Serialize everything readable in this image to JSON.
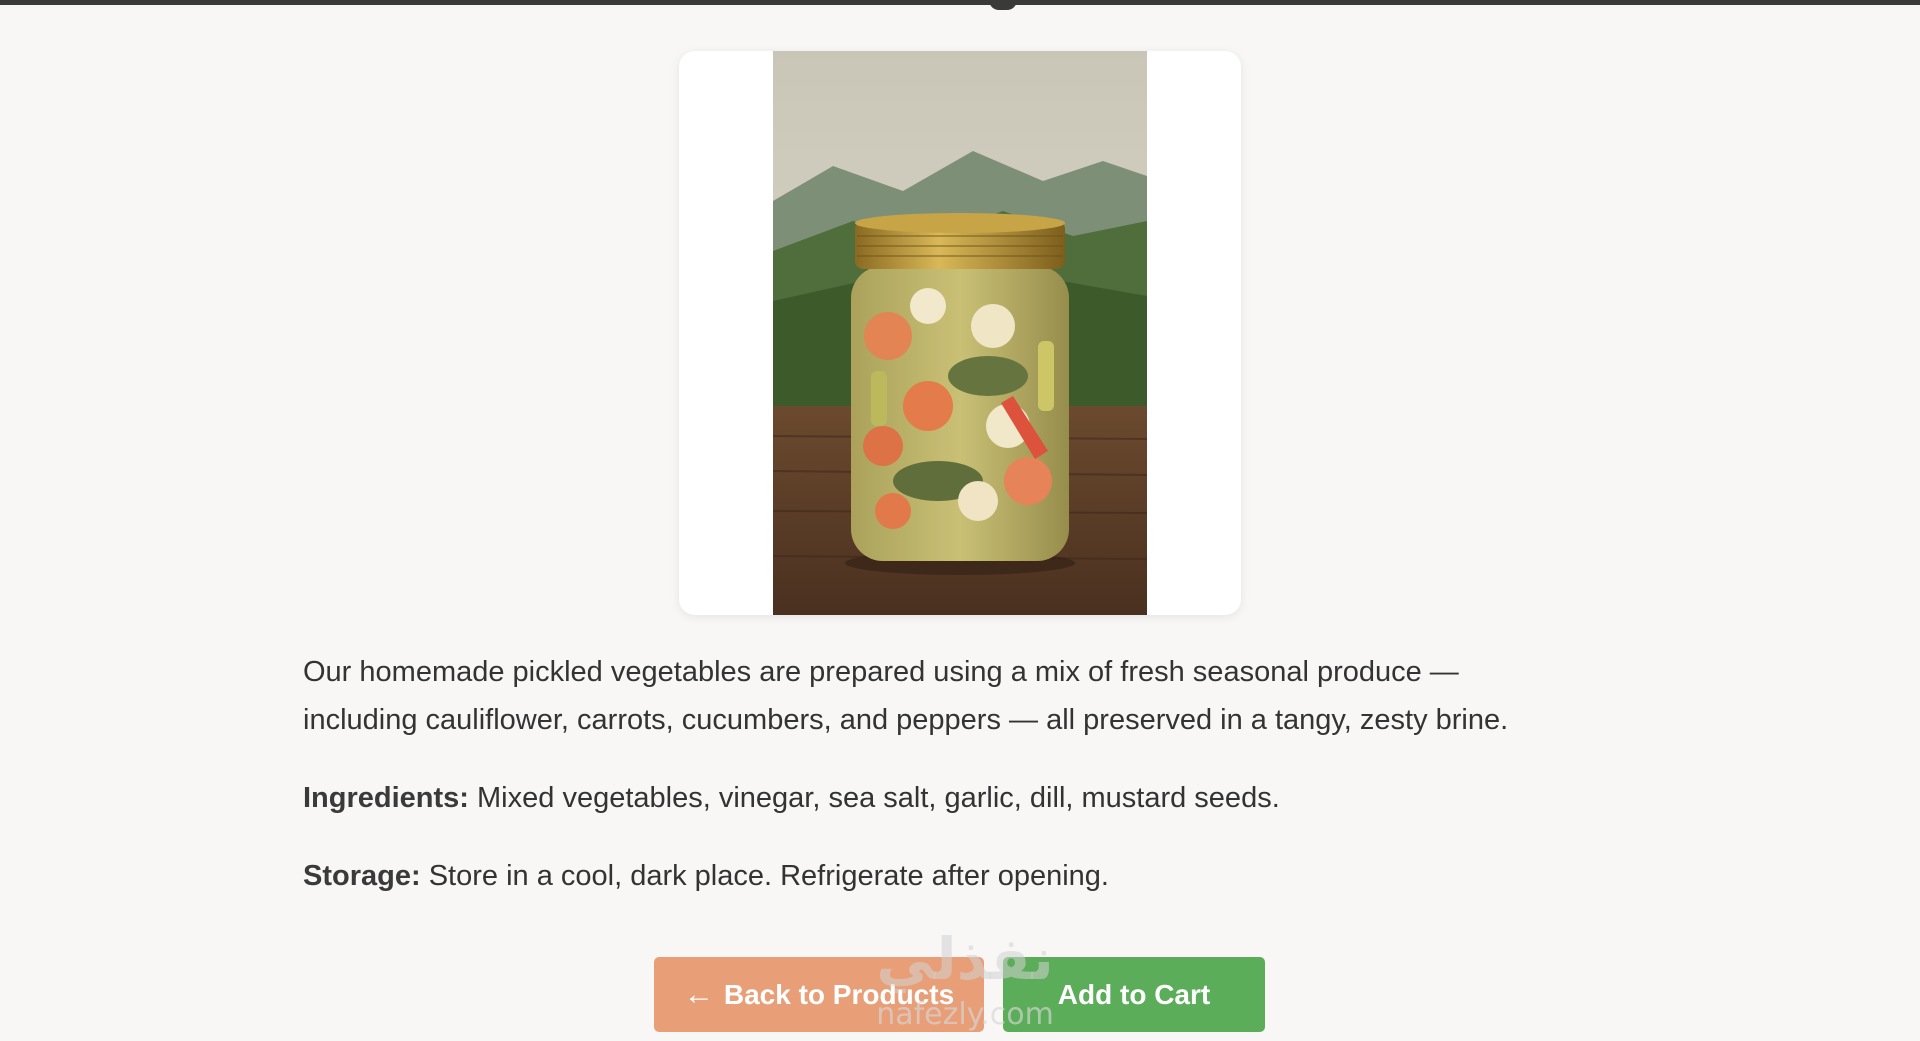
{
  "product": {
    "image_alt": "Jar of homemade pickled vegetables",
    "description": "Our homemade pickled vegetables are prepared using a mix of fresh seasonal produce — including cauliflower, carrots, cucumbers, and peppers — all preserved in a tangy, zesty brine.",
    "ingredients_label": "Ingredients:",
    "ingredients_value": " Mixed vegetables, vinegar, sea salt, garlic, dill, mustard seeds.",
    "storage_label": "Storage:",
    "storage_value": " Store in a cool, dark place. Refrigerate after opening."
  },
  "actions": {
    "back_icon": "left-arrow-icon",
    "back_label": "Back to Products",
    "cart_label": "Add to Cart"
  },
  "watermark": {
    "arabic": "نفذلي",
    "latin": "nafezly.com"
  },
  "colors": {
    "background": "#f9f7f5",
    "back_button": "#e89f78",
    "cart_button": "#5cad5a",
    "text": "#333333"
  }
}
